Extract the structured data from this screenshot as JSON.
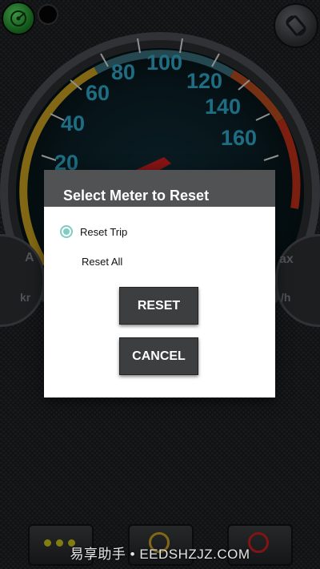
{
  "app": {
    "gauge_tick_labels": [
      "20",
      "40",
      "60",
      "80",
      "100",
      "120",
      "140",
      "160"
    ],
    "left_gauge_letter": "A",
    "left_gauge_unit": "kr",
    "right_gauge_letter": "ax",
    "right_gauge_unit": "/h",
    "icons": {
      "gps": "gps-satellite-icon",
      "rotate": "screen-rotate-icon",
      "more": "more-dots-icon",
      "pause": "pause-ring-icon",
      "stop": "stop-ring-icon"
    }
  },
  "dialog": {
    "title": "Select Meter to Reset",
    "options": [
      {
        "label": "Reset Trip",
        "selected": true
      },
      {
        "label": "Reset All",
        "selected": false
      }
    ],
    "reset_label": "RESET",
    "cancel_label": "CANCEL"
  },
  "watermark": "易享助手 • EEDSHZJZ.COM",
  "colors": {
    "accent": "#80cbc4",
    "gauge_numbers": "#2fa8c8",
    "dialog_header": "#505254",
    "button_bg": "#3c3e40"
  }
}
